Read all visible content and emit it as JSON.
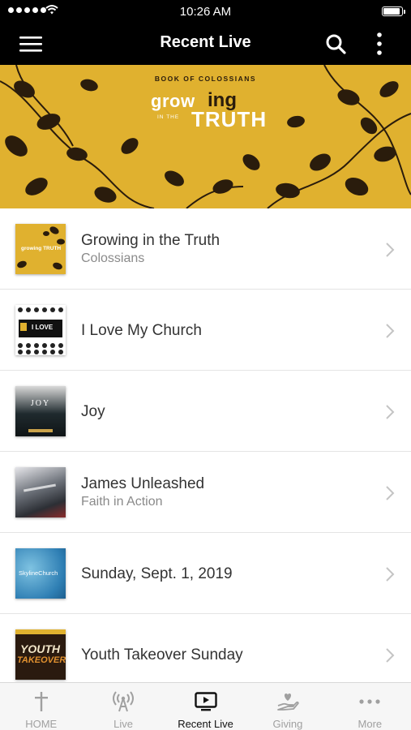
{
  "status_bar": {
    "time": "10:26 AM"
  },
  "nav": {
    "title": "Recent Live"
  },
  "banner": {
    "kicker": "BOOK OF COLOSSIANS",
    "logo_growing_a": "grow",
    "logo_growing_b": "ing",
    "logo_in_the": "IN THE",
    "logo_truth": "TRUTH"
  },
  "items": [
    {
      "title": "Growing in the Truth",
      "subtitle": "Colossians"
    },
    {
      "title": "I Love My Church",
      "subtitle": ""
    },
    {
      "title": "Joy",
      "subtitle": ""
    },
    {
      "title": "James Unleashed",
      "subtitle": "Faith in Action"
    },
    {
      "title": "Sunday, Sept. 1, 2019",
      "subtitle": ""
    },
    {
      "title": "Youth Takeover Sunday",
      "subtitle": ""
    }
  ],
  "thumb_text": {
    "growing": "growing TRUTH",
    "love": "I LOVE",
    "joy": "JOY",
    "skyline": "SkylineChurch",
    "youth_a": "YOUTH",
    "youth_b": "TAKEOVER"
  },
  "tabs": [
    {
      "label": "HOME",
      "icon": "cross-icon"
    },
    {
      "label": "Live",
      "icon": "broadcast-icon"
    },
    {
      "label": "Recent Live",
      "icon": "tv-play-icon",
      "active": true
    },
    {
      "label": "Giving",
      "icon": "giving-hand-icon"
    },
    {
      "label": "More",
      "icon": "more-dots-icon"
    }
  ],
  "colors": {
    "bar": "#000000",
    "banner": "#e0b12f",
    "active_tab": "#111111",
    "inactive_tab": "#a0a0a0"
  }
}
